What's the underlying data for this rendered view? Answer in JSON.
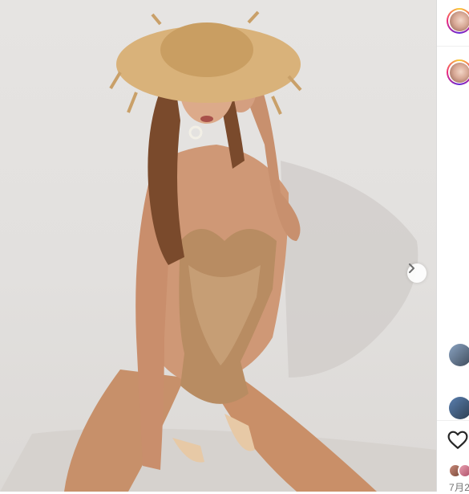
{
  "post": {
    "carousel_next_icon": "chevron-right-icon"
  },
  "sidebar": {
    "date_label": "7月2"
  },
  "icons": {
    "like": "heart-outline-icon"
  },
  "colors": {
    "story_ring": "#ee2a7b",
    "divider": "#efefef",
    "meta_text": "#737373"
  }
}
